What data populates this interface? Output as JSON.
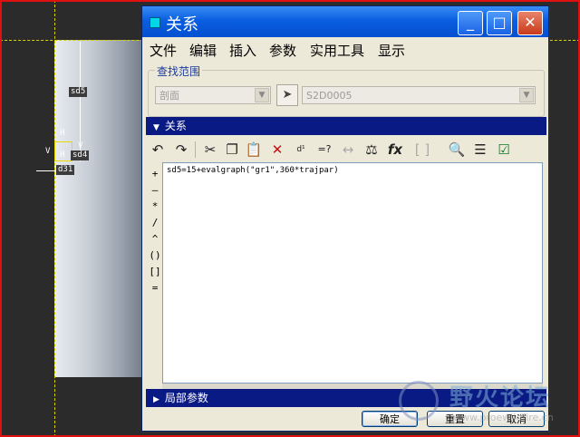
{
  "cad": {
    "dims": {
      "sd5": "sd5",
      "sd4": "sd4",
      "d31": "d31"
    },
    "tags": {
      "h_top": "H",
      "v_mid": "V",
      "h_mid": "H",
      "v_left": "V"
    }
  },
  "dialog": {
    "title": "关系",
    "window_buttons": {
      "minimize": "_",
      "maximize": "□",
      "close": "✕"
    },
    "menu": [
      "文件",
      "编辑",
      "插入",
      "参数",
      "实用工具",
      "显示"
    ],
    "search_scope": {
      "label": "查找范围",
      "scope_value": "剖面",
      "object_value": "S2D0005"
    },
    "relations_section": {
      "label": "关系",
      "expanded": true
    },
    "toolbar": [
      "undo-icon",
      "redo-icon",
      "cut-icon",
      "copy-icon",
      "paste-icon",
      "delete-icon",
      "sd-icon",
      "eval-icon",
      "measure-icon",
      "units-icon",
      "function-icon",
      "brackets-icon",
      "verify-icon",
      "sort-icon",
      "check-icon"
    ],
    "operators": [
      "+",
      "—",
      "*",
      "/",
      "^",
      "()",
      "[]",
      "="
    ],
    "relation_text": "sd5=15+evalgraph(\"gr1\",360*trajpar)",
    "local_params_section": {
      "label": "局部参数",
      "expanded": false
    },
    "buttons": {
      "ok": "确定",
      "reset": "重置",
      "cancel": "取消"
    }
  },
  "watermark": {
    "text": "野火论坛",
    "url": "www.proewildfire.cn"
  },
  "colors": {
    "title_bar": "#0a5ee0",
    "section_bar": "#0a1a84",
    "dialog_bg": "#ece9d8",
    "frame": "#e01010"
  }
}
